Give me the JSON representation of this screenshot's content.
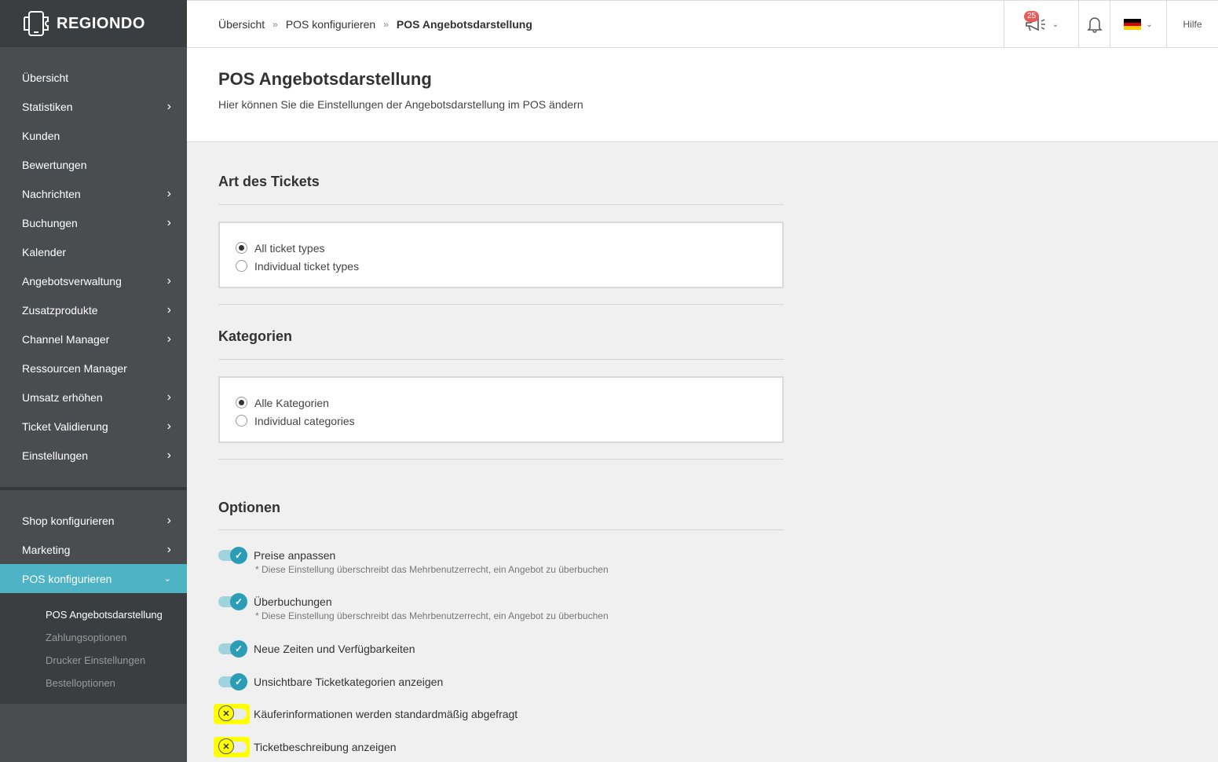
{
  "brand": {
    "name": "REGIONDO"
  },
  "sidebar": {
    "items": [
      {
        "label": "Übersicht",
        "has_children": false
      },
      {
        "label": "Statistiken",
        "has_children": true
      },
      {
        "label": "Kunden",
        "has_children": false
      },
      {
        "label": "Bewertungen",
        "has_children": false
      },
      {
        "label": "Nachrichten",
        "has_children": true
      },
      {
        "label": "Buchungen",
        "has_children": true
      },
      {
        "label": "Kalender",
        "has_children": false
      },
      {
        "label": "Angebotsverwaltung",
        "has_children": true
      },
      {
        "label": "Zusatzprodukte",
        "has_children": true
      },
      {
        "label": "Channel Manager",
        "has_children": true
      },
      {
        "label": "Ressourcen Manager",
        "has_children": false
      },
      {
        "label": "Umsatz erhöhen",
        "has_children": true
      },
      {
        "label": "Ticket Validierung",
        "has_children": true
      },
      {
        "label": "Einstellungen",
        "has_children": true
      }
    ],
    "secondary_items": [
      {
        "label": "Shop konfigurieren",
        "has_children": true
      },
      {
        "label": "Marketing",
        "has_children": true
      },
      {
        "label": "POS konfigurieren",
        "has_children": true,
        "active": true
      }
    ],
    "subitems": [
      {
        "label": "POS Angebotsdarstellung",
        "current": true
      },
      {
        "label": "Zahlungsoptionen"
      },
      {
        "label": "Drucker Einstellungen"
      },
      {
        "label": "Bestelloptionen"
      }
    ],
    "colors": {
      "bg": "#4a4d50",
      "active": "#4eb3c4"
    }
  },
  "header": {
    "breadcrumb": [
      "Übersicht",
      "POS konfigurieren",
      "POS Angebotsdarstellung"
    ],
    "breadcrumb_separator": "»",
    "promo_badge": "25",
    "help_label": "Hilfe",
    "language_flag": "flag-de-icon"
  },
  "page": {
    "title": "POS Angebotsdarstellung",
    "subtitle": "Hier können Sie die Einstellungen der Angebotsdarstellung im POS ändern"
  },
  "sections": {
    "ticket_type": {
      "title": "Art des Tickets",
      "options": [
        "All ticket types",
        "Individual ticket types"
      ],
      "selected": "All ticket types"
    },
    "categories": {
      "title": "Kategorien",
      "options": [
        "Alle Kategorien",
        "Individual categories"
      ],
      "selected": "Alle Kategorien"
    },
    "options": {
      "title": "Optionen",
      "items": [
        {
          "label": "Preise anpassen",
          "enabled": true,
          "note": "* Diese Einstellung überschreibt das Mehrbenutzerrecht, ein Angebot zu überbuchen"
        },
        {
          "label": "Überbuchungen",
          "enabled": true,
          "note": "* Diese Einstellung überschreibt das Mehrbenutzerrecht, ein Angebot zu überbuchen"
        },
        {
          "label": "Neue Zeiten und Verfügbarkeiten",
          "enabled": true
        },
        {
          "label": "Unsichtbare Ticketkategorien anzeigen",
          "enabled": true
        },
        {
          "label": "Käuferinformationen werden standardmäßig abgefragt",
          "enabled": false,
          "highlighted": true
        },
        {
          "label": "Ticketbeschreibung anzeigen",
          "enabled": false,
          "highlighted": true
        }
      ]
    }
  }
}
